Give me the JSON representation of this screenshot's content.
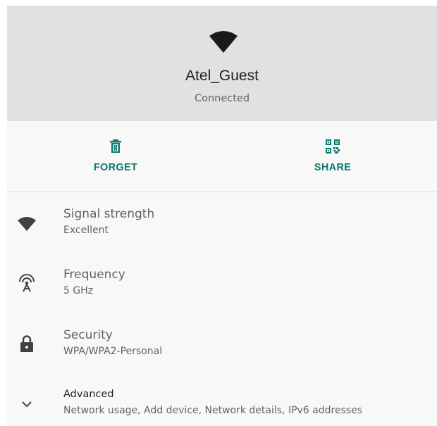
{
  "network": {
    "ssid": "Atel_Guest",
    "status": "Connected"
  },
  "actions": {
    "forget_label": "FORGET",
    "share_label": "SHARE"
  },
  "details": {
    "signal": {
      "title": "Signal strength",
      "value": "Excellent"
    },
    "frequency": {
      "title": "Frequency",
      "value": "5 GHz"
    },
    "security": {
      "title": "Security",
      "value": "WPA/WPA2-Personal"
    },
    "advanced": {
      "title": "Advanced",
      "summary": "Network usage, Add device, Network details, IPv6 addresses"
    }
  },
  "colors": {
    "accent": "#0b7a6f",
    "header_bg": "#e1e1e1",
    "page_bg": "#f8f8f8",
    "icon": "#424242"
  }
}
